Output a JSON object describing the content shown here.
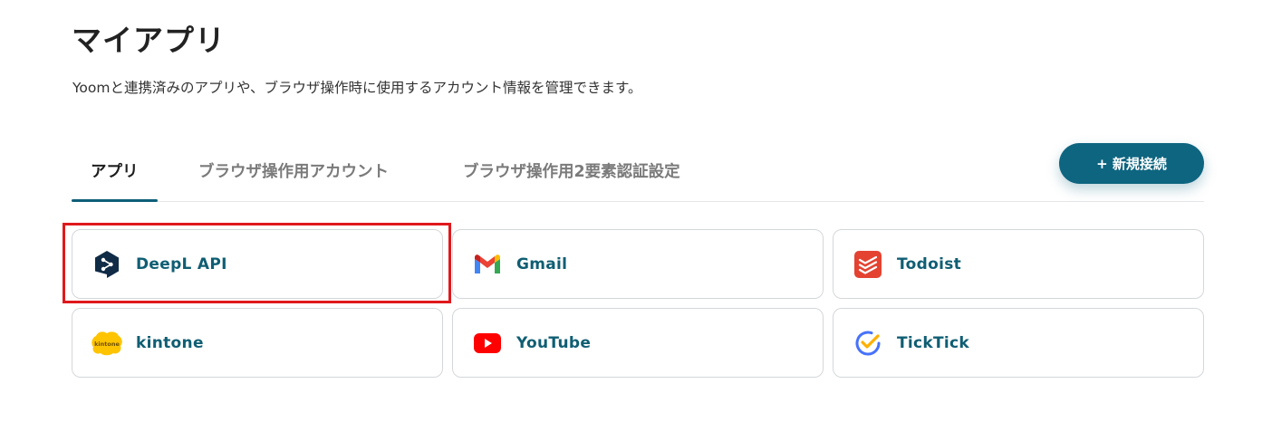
{
  "header": {
    "title": "マイアプリ",
    "description": "Yoomと連携済みのアプリや、ブラウザ操作時に使用するアカウント情報を管理できます。"
  },
  "tabs": [
    {
      "label": "アプリ",
      "active": true
    },
    {
      "label": "ブラウザ操作用アカウント",
      "active": false
    },
    {
      "label": "ブラウザ操作用2要素認証設定",
      "active": false
    }
  ],
  "actions": {
    "new_connection_label": "+ 新規接続"
  },
  "apps": [
    {
      "name": "DeepL API",
      "icon": "deepl-icon"
    },
    {
      "name": "Gmail",
      "icon": "gmail-icon"
    },
    {
      "name": "Todoist",
      "icon": "todoist-icon"
    },
    {
      "name": "kintone",
      "icon": "kintone-icon",
      "icon_text": "kintone"
    },
    {
      "name": "YouTube",
      "icon": "youtube-icon"
    },
    {
      "name": "TickTick",
      "icon": "ticktick-icon"
    }
  ],
  "colors": {
    "accent": "#0e6580",
    "app_name": "#0f5e73",
    "highlight": "#e0181c"
  }
}
